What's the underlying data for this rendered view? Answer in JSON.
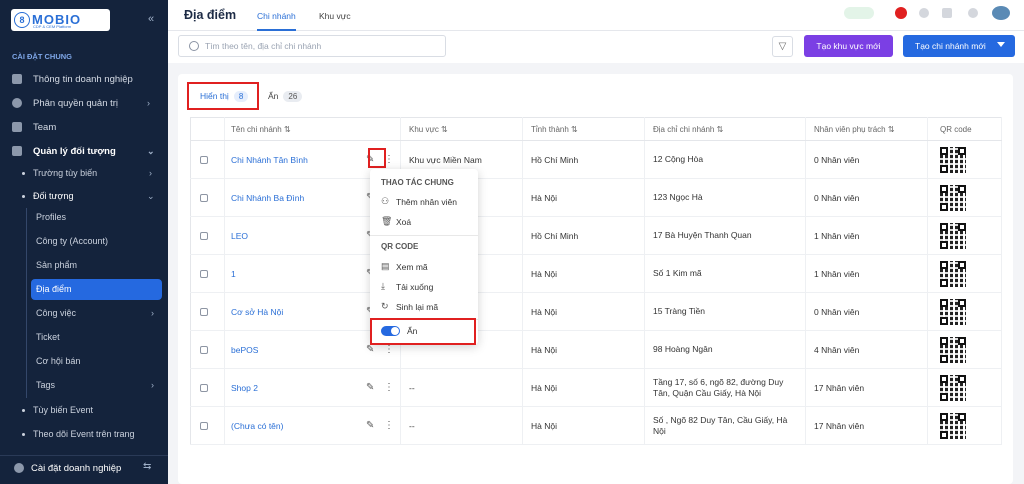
{
  "sidebar": {
    "logo": "MOBIO",
    "logo_sub": "CDP & CEM Platform",
    "section": "CÀI ĐẶT CHUNG",
    "items": [
      "Thông tin doanh nghiệp",
      "Phân quyền quản trị",
      "Team",
      "Quản lý đối tượng"
    ],
    "sub": [
      "Trường tùy biến",
      "Đối tượng"
    ],
    "objects": [
      "Profiles",
      "Công ty (Account)",
      "Sản phẩm",
      "Địa điểm",
      "Công việc",
      "Ticket",
      "Cơ hội bán",
      "Tags"
    ],
    "after": [
      "Tùy biến Event",
      "Theo dõi Event trên trang"
    ],
    "bottom": "Cài đặt doanh nghiệp"
  },
  "header": {
    "title": "Địa điểm",
    "tabs": [
      "Chi nhánh",
      "Khu vực"
    ]
  },
  "toolbar": {
    "search_placeholder": "Tìm theo tên, địa chỉ chi nhánh",
    "btn_region": "Tạo khu vực mới",
    "btn_branch": "Tạo chi nhánh mới"
  },
  "subtabs": {
    "shown": "Hiển thị",
    "shown_count": "8",
    "hidden": "Ẩn",
    "hidden_count": "26"
  },
  "table": {
    "headers": [
      "Tên chi nhánh",
      "Khu vực",
      "Tỉnh thành",
      "Địa chỉ chi nhánh",
      "Nhân viên phụ trách",
      "QR code"
    ],
    "rows": [
      [
        "Chi Nhánh Tân Bình",
        "Khu vực Miền Nam",
        "Hồ Chí Minh",
        "12 Cộng Hòa",
        "0 Nhân viên"
      ],
      [
        "Chi Nhánh Ba Đình",
        "",
        "Hà Nội",
        "123 Ngọc Hà",
        "0 Nhân viên"
      ],
      [
        "LEO",
        "",
        "Hồ Chí Minh",
        "17 Bà Huyện Thanh Quan",
        "1 Nhân viên"
      ],
      [
        "1",
        "",
        "Hà Nội",
        "Số 1 Kim mã",
        "1 Nhân viên"
      ],
      [
        "Cơ sở Hà Nội",
        "",
        "Hà Nội",
        "15 Tràng Tiền",
        "0 Nhân viên"
      ],
      [
        "bePOS",
        "",
        "Hà Nội",
        "98 Hoàng Ngân",
        "4 Nhân viên"
      ],
      [
        "Shop 2",
        "--",
        "Hà Nội",
        "Tầng 17, số 6, ngõ 82, đường Duy Tân, Quận Cầu Giấy, Hà Nội",
        "17 Nhân viên"
      ],
      [
        "(Chưa có tên)",
        "--",
        "Hà Nội",
        "Số , Ngõ 82 Duy Tân, Cầu Giấy, Hà Nội",
        "17 Nhân viên"
      ]
    ]
  },
  "menu": {
    "general": "THAO TÁC CHUNG",
    "add_staff": "Thêm nhân viên",
    "delete": "Xoá",
    "qr": "QR CODE",
    "view": "Xem mã",
    "download": "Tải xuống",
    "regen": "Sinh lại mã",
    "hide": "Ẩn"
  }
}
